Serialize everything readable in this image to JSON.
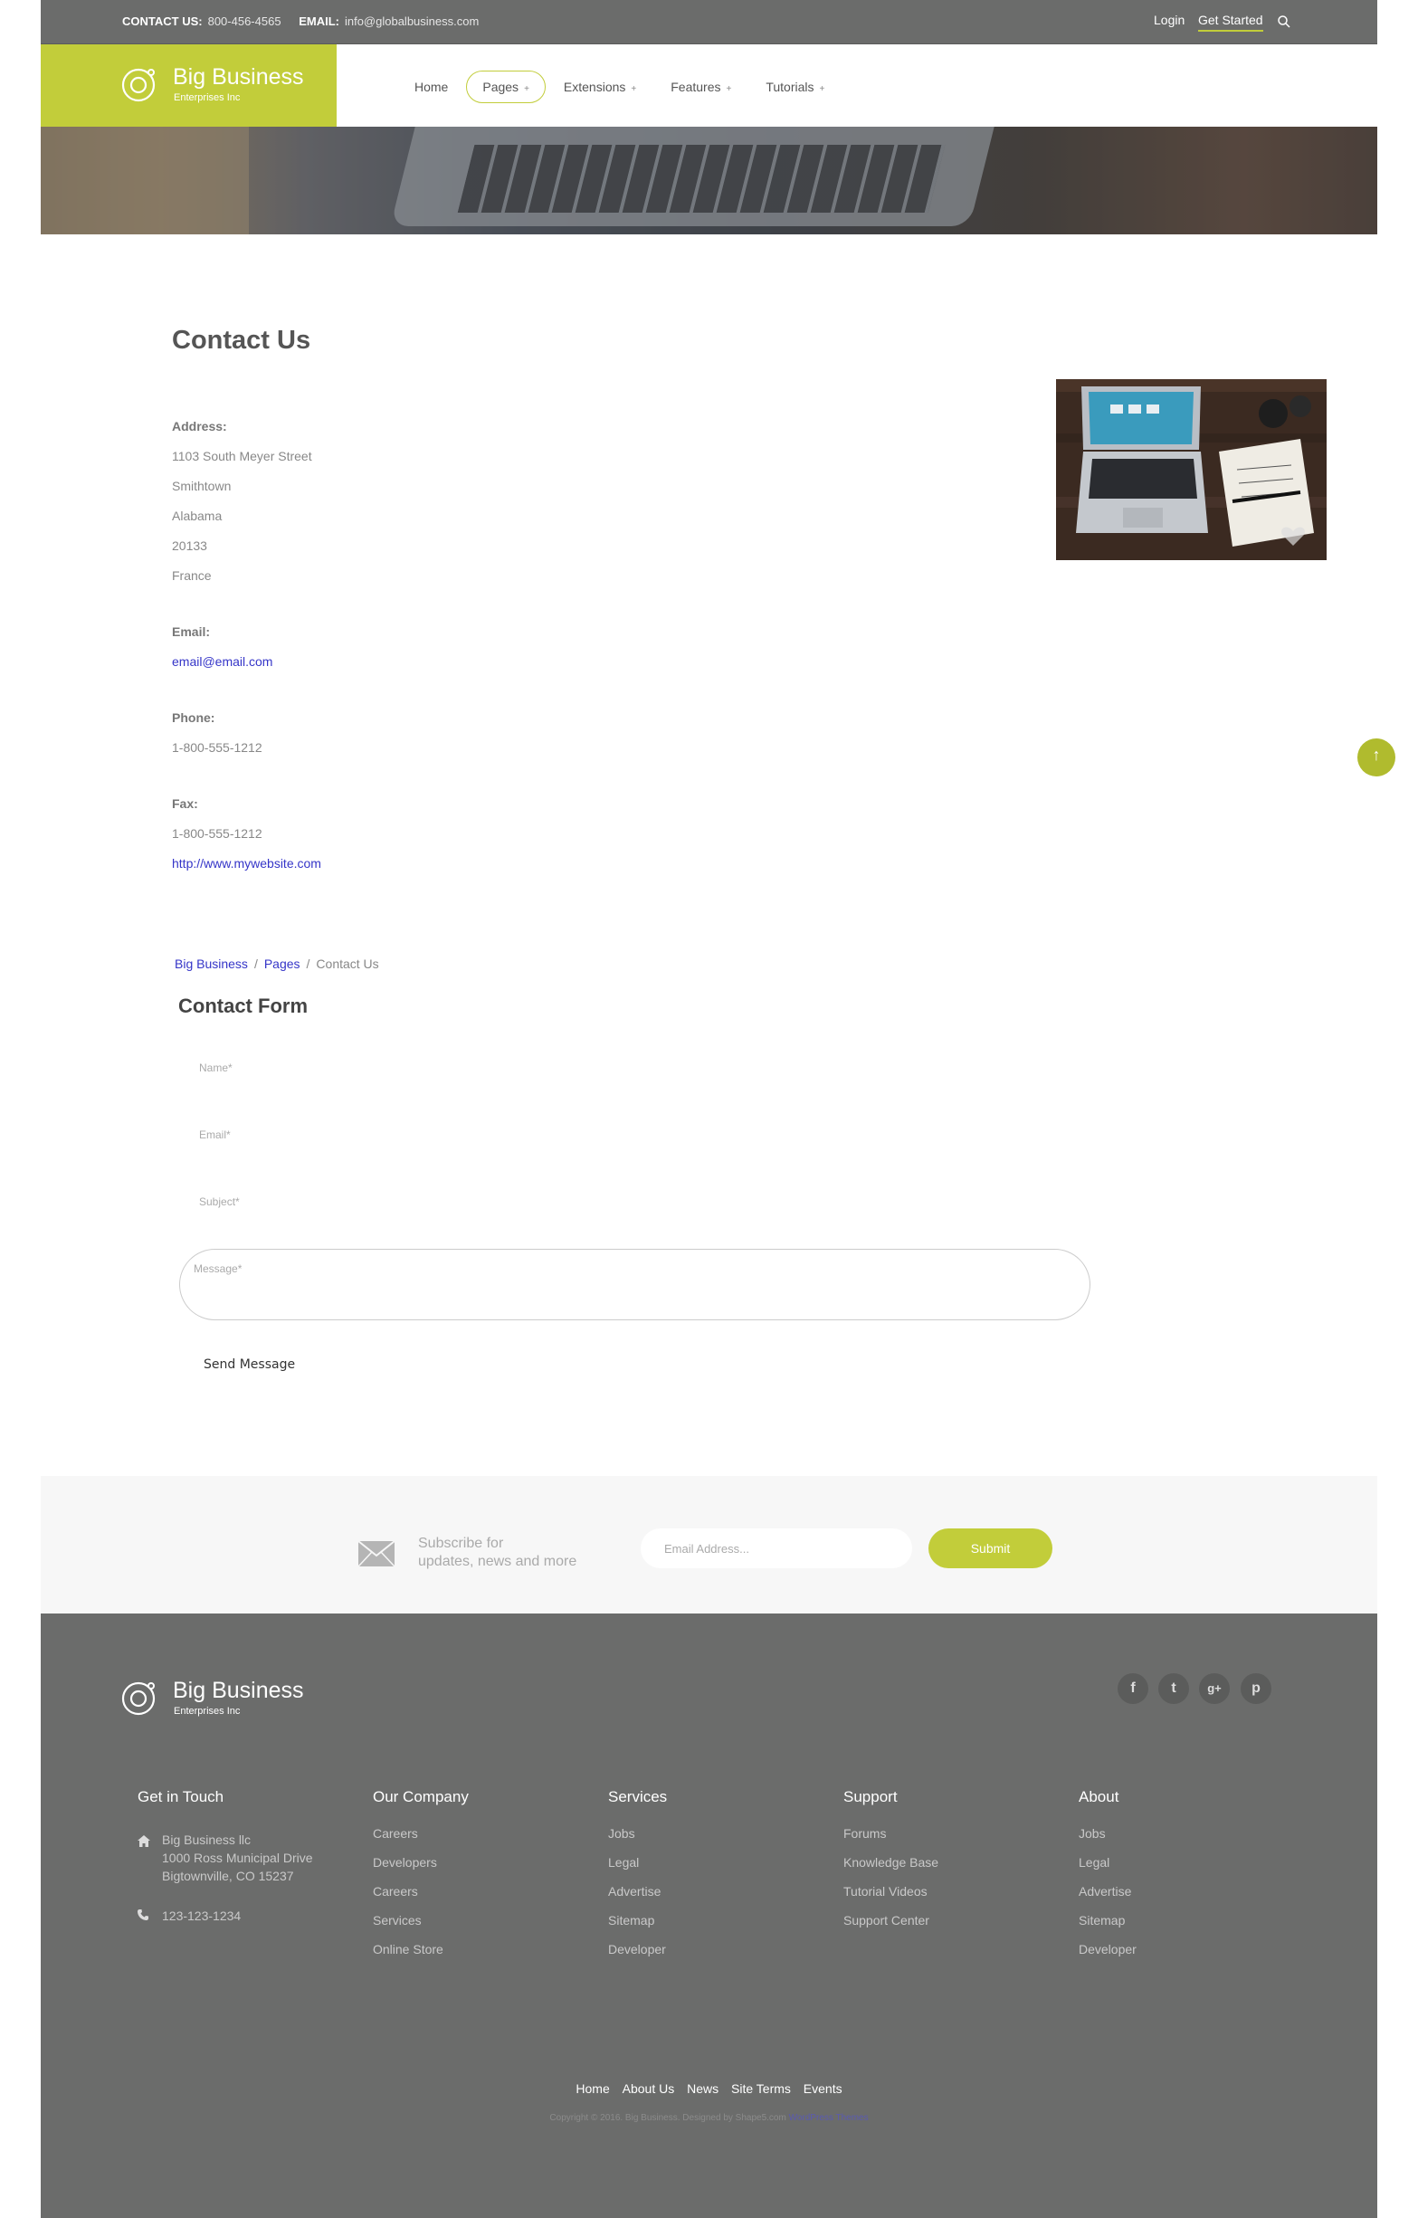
{
  "topbar": {
    "contact_label": "CONTACT US:",
    "contact_phone": "800-456-4565",
    "email_label": "EMAIL:",
    "email_value": "info@globalbusiness.com",
    "login": "Login",
    "get_started": "Get Started"
  },
  "brand": {
    "name": "Big Business",
    "tagline": "Enterprises Inc"
  },
  "nav": [
    {
      "label": "Home",
      "plus": ""
    },
    {
      "label": "Pages",
      "plus": "+"
    },
    {
      "label": "Extensions",
      "plus": "+"
    },
    {
      "label": "Features",
      "plus": "+"
    },
    {
      "label": "Tutorials",
      "plus": "+"
    }
  ],
  "contact": {
    "title": "Contact Us",
    "address_label": "Address:",
    "address_lines": [
      "1103 South Meyer Street",
      "Smithtown",
      "Alabama",
      "20133",
      "France"
    ],
    "email_label": "Email:",
    "email": "email@email.com",
    "phone_label": "Phone:",
    "phone": "1-800-555-1212",
    "fax_label": "Fax:",
    "fax": "1-800-555-1212",
    "website": "http://www.mywebsite.com"
  },
  "breadcrumb": {
    "home": "Big Business",
    "sep": "/",
    "pages": "Pages",
    "current": "Contact Us"
  },
  "form": {
    "title": "Contact Form",
    "name_placeholder": "Name*",
    "email_placeholder": "Email*",
    "subject_placeholder": "Subject*",
    "message_placeholder": "Message*",
    "send_label": "Send Message"
  },
  "subscribe": {
    "line1": "Subscribe for",
    "line2": "updates, news and more",
    "email_placeholder": "Email Address...",
    "submit": "Submit"
  },
  "footer": {
    "social": [
      "f",
      "t",
      "g+",
      "p"
    ],
    "get_in_touch": {
      "title": "Get in Touch",
      "address": [
        "Big Business llc",
        "1000 Ross Municipal Drive",
        "Bigtownville, CO 15237"
      ],
      "phone": "123-123-1234"
    },
    "columns": [
      {
        "title": "Our Company",
        "items": [
          "Careers",
          "Developers",
          "Careers",
          "Services",
          "Online Store"
        ]
      },
      {
        "title": "Services",
        "items": [
          "Jobs",
          "Legal",
          "Advertise",
          "Sitemap",
          "Developer"
        ]
      },
      {
        "title": "Support",
        "items": [
          "Forums",
          "Knowledge Base",
          "Tutorial Videos",
          "Support Center"
        ]
      },
      {
        "title": "About",
        "items": [
          "Jobs",
          "Legal",
          "Advertise",
          "Sitemap",
          "Developer"
        ]
      }
    ],
    "bottom_nav": [
      "Home",
      "About Us",
      "News",
      "Site Terms",
      "Events"
    ],
    "copyright": "Copyright © 2016. Big Business. Designed by Shape5.com",
    "theme_link": "WordPress Themes"
  },
  "colors": {
    "accent": "#c2cd3a",
    "dark": "#6b6c6b",
    "link": "#3535c8"
  }
}
